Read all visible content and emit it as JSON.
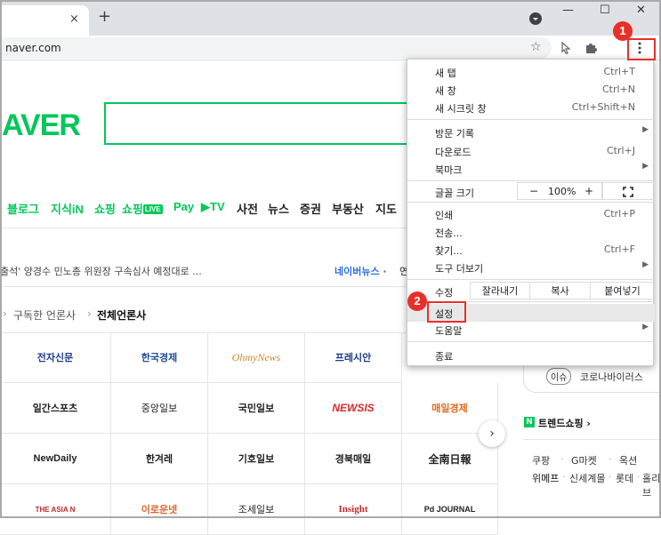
{
  "browser": {
    "url": "naver.com",
    "tab_close": "×",
    "new_tab": "+",
    "win_minimize": "—",
    "win_maximize": "☐",
    "win_close": "✕"
  },
  "annotations": {
    "badge1": "1",
    "badge2": "2"
  },
  "naver": {
    "logo": "AVER",
    "services": [
      "블로그",
      "지식iN",
      "쇼핑",
      "쇼핑",
      "LIVE",
      "Pay",
      "TV",
      "사전",
      "뉴스",
      "증권",
      "부동산",
      "지도"
    ],
    "headline": "출석' 양경수 민노총 위원장 구속심사 예정대로 ...",
    "naver_news": "네이버뉴스 ·",
    "naver_news_more": "연",
    "crumb_sep": "›",
    "crumb_subscribed": "구독한 언론사",
    "crumb_all": "전체언론사",
    "press": [
      [
        "전자신문",
        "한국경제",
        "OhmyNews",
        "프레시안"
      ],
      [
        "일간스포츠",
        "중앙일보",
        "국민일보",
        "NEWSIS",
        "매일경제"
      ],
      [
        "NewDaily",
        "한겨레",
        "기호일보",
        "경북매일",
        "全南日報"
      ],
      [
        "THE ASIA N",
        "이로운넷",
        "조세일보",
        "Insight",
        "Pd JOURNAL"
      ]
    ],
    "next_arrow": "›",
    "issue_tag": "이슈",
    "issue_text": "코로나바이러스",
    "trend_logo": "N",
    "trend_title": "트렌드쇼핑 ›",
    "shop_row1": [
      "쿠팡",
      "·",
      "G마켓",
      "·",
      "옥션"
    ],
    "shop_row2": [
      "위메프",
      "·",
      "신세계몰",
      "·",
      "롯데",
      "·",
      "홀리브"
    ]
  },
  "menu": {
    "new_tab": "새 탭",
    "new_tab_sc": "Ctrl+T",
    "new_window": "새 창",
    "new_window_sc": "Ctrl+N",
    "incognito": "새 시크릿 창",
    "incognito_sc": "Ctrl+Shift+N",
    "history": "방문 기록",
    "downloads": "다운로드",
    "downloads_sc": "Ctrl+J",
    "bookmarks": "북마크",
    "zoom_label": "글꼴 크기",
    "zoom_minus": "−",
    "zoom_value": "100%",
    "zoom_plus": "+",
    "print": "인쇄",
    "print_sc": "Ctrl+P",
    "cast": "전송...",
    "find": "찾기...",
    "find_sc": "Ctrl+F",
    "more_tools": "도구 더보기",
    "edit": "수정",
    "cut": "잘라내기",
    "copy": "복사",
    "paste": "붙여넣기",
    "settings": "설정",
    "help": "도움말",
    "exit": "종료"
  }
}
